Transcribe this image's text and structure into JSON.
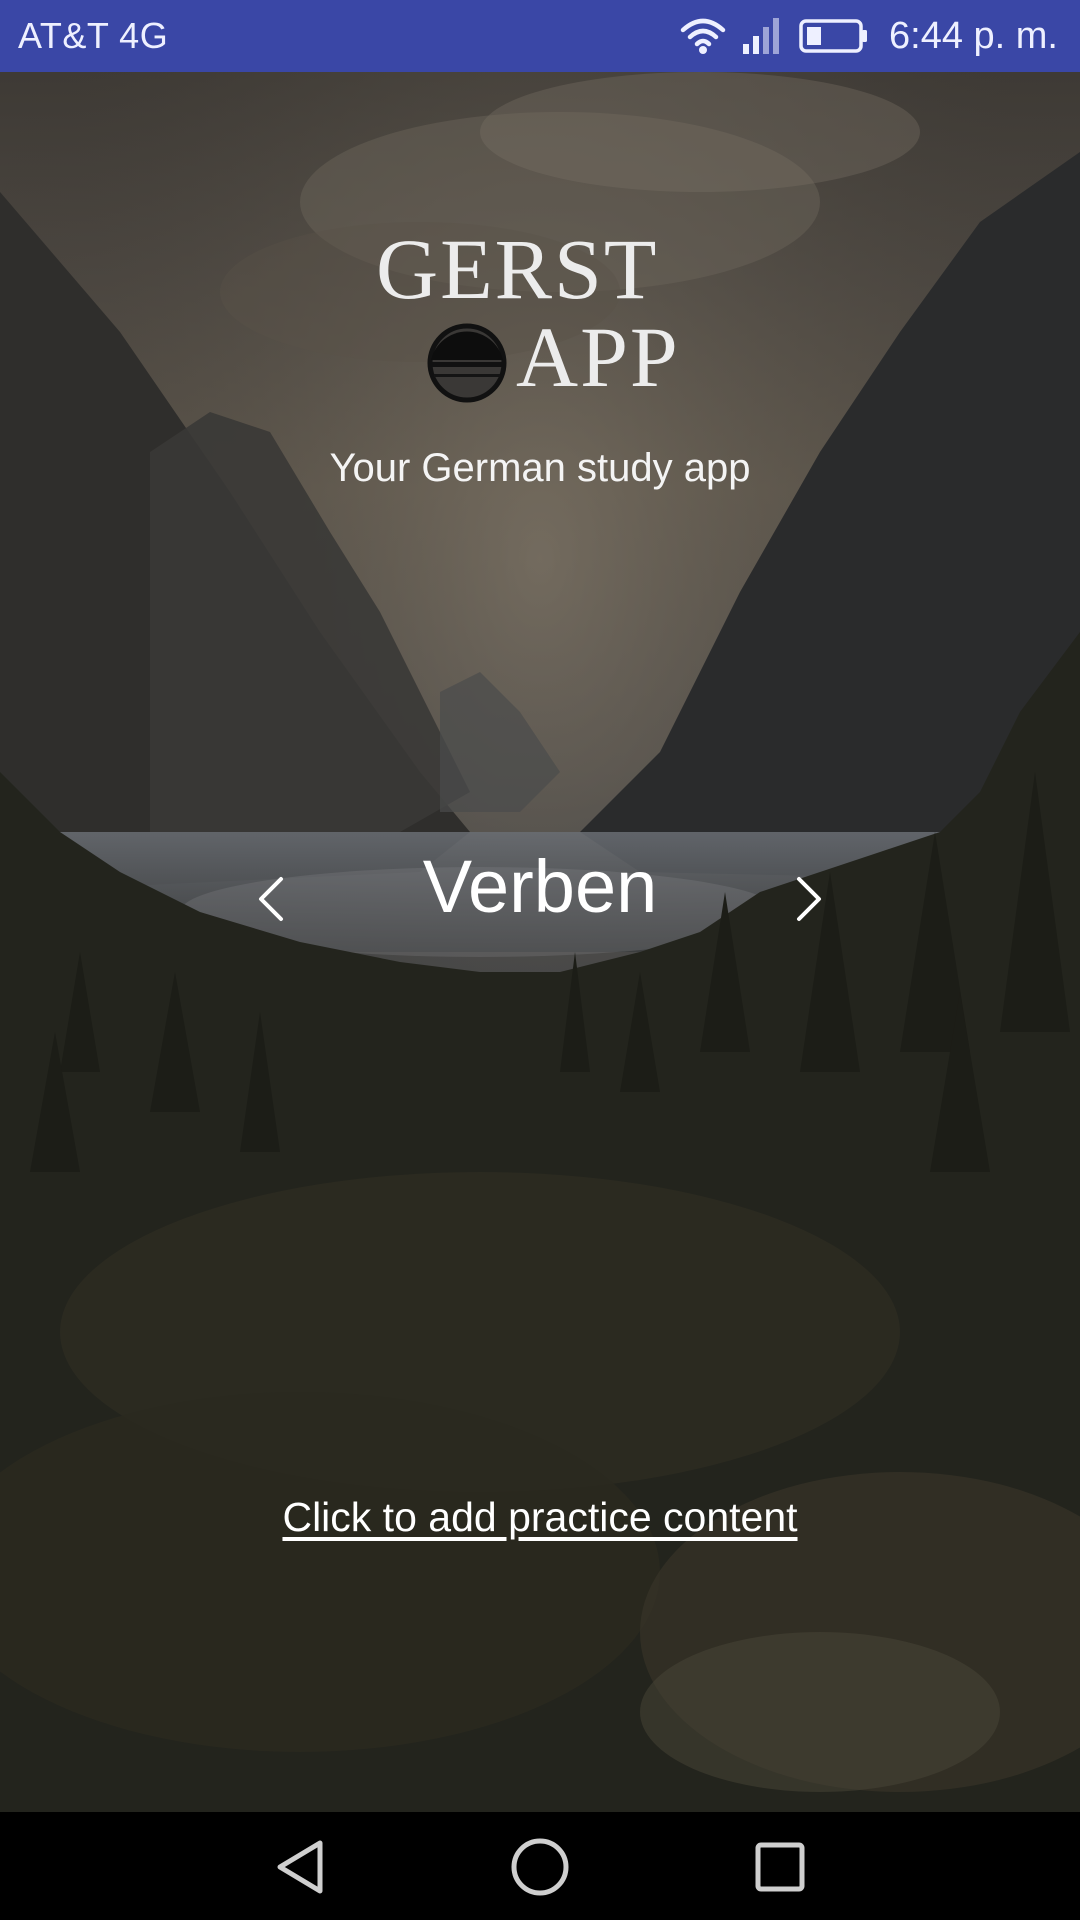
{
  "status_bar": {
    "carrier": "AT&T 4G",
    "time": "6:44 p. m.",
    "icons": [
      "wifi-icon",
      "signal-icon",
      "battery-icon"
    ],
    "background_color": "#3a47a6"
  },
  "logo": {
    "line1": "GERST",
    "line2": "APP",
    "emblem_icon": "half-circle-emblem-icon"
  },
  "tagline": "Your German study app",
  "category": {
    "title": "Verben",
    "prev_icon": "chevron-left-icon",
    "next_icon": "chevron-right-icon"
  },
  "add_content_link": "Click to add practice content",
  "nav_bar": {
    "icons": [
      "back-icon",
      "home-icon",
      "recents-icon"
    ],
    "background_color": "#000000"
  }
}
